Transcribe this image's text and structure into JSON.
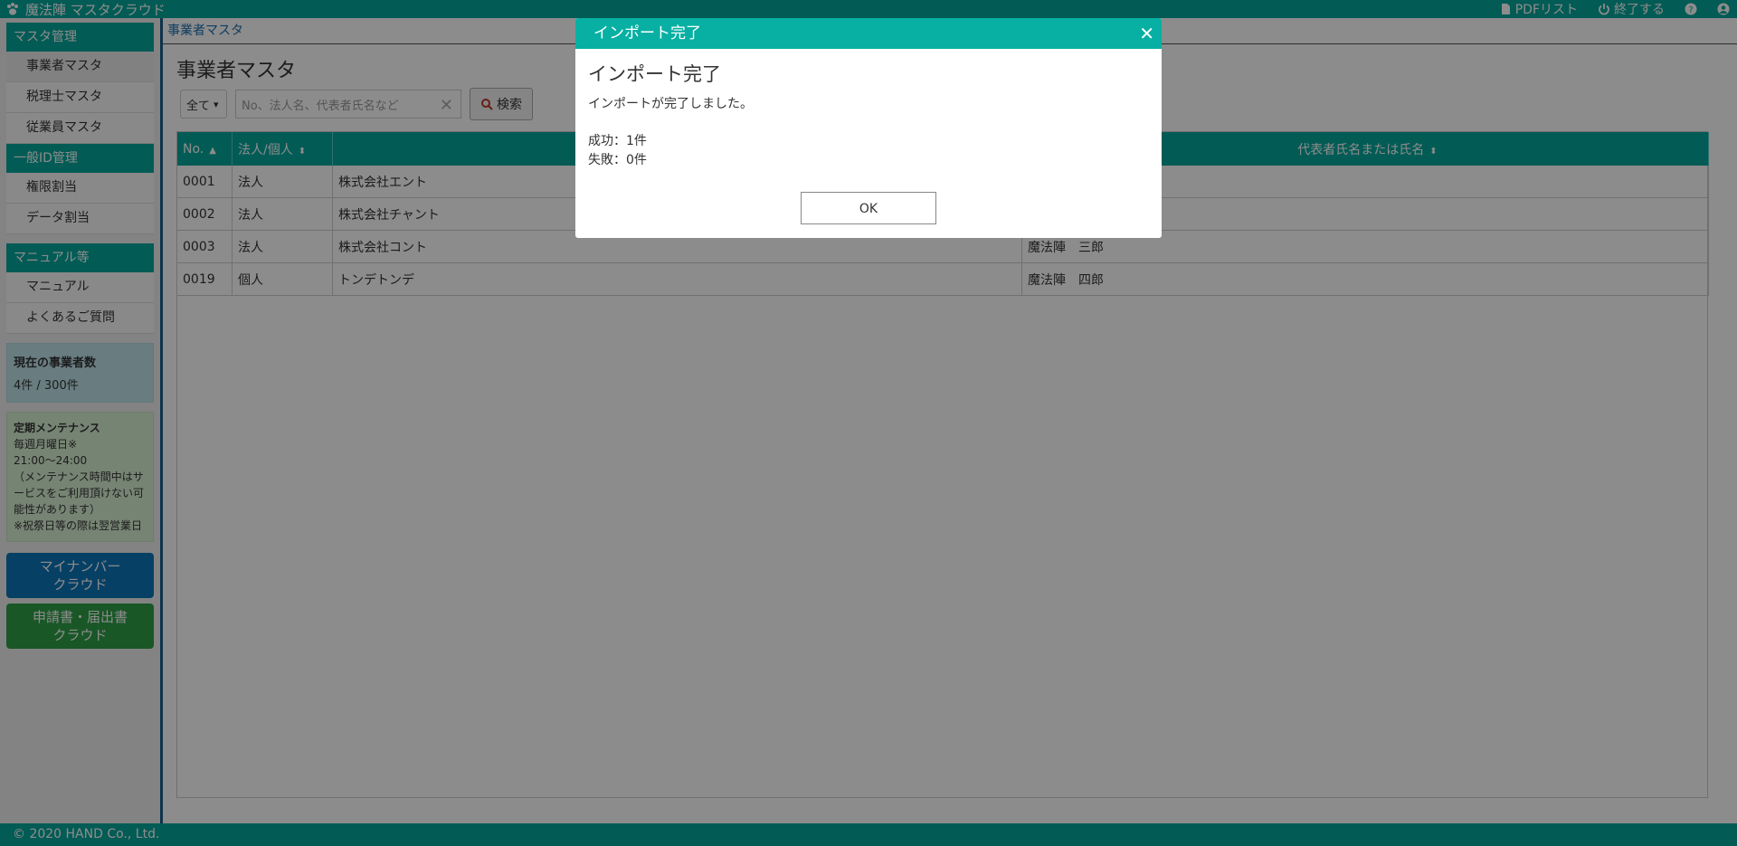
{
  "app": {
    "title": "魔法陣 マスタクラウド",
    "header_links": [
      {
        "label": "PDFリスト",
        "icon": "file-icon"
      },
      {
        "label": "終了する",
        "icon": "power-icon"
      },
      {
        "label": "",
        "icon": "help-icon"
      },
      {
        "label": "",
        "icon": "user-icon"
      }
    ]
  },
  "sidebar": {
    "groups": [
      {
        "title": "マスタ管理",
        "items": [
          "事業者マスタ",
          "税理士マスタ",
          "従業員マスタ"
        ]
      },
      {
        "title": "一般ID管理",
        "items": [
          "権限割当",
          "データ割当"
        ]
      },
      {
        "title": "マニュアル等",
        "items": [
          "マニュアル",
          "よくあるご質問"
        ]
      }
    ],
    "count_box": {
      "title": "現在の事業者数",
      "value": "4件 / 300件"
    },
    "maintenance": {
      "title": "定期メンテナンス",
      "lines": [
        "毎週月曜日※",
        "21:00〜24:00",
        "（メンテナンス時間中はサービスをご利用頂けない可能性があります）",
        "※祝祭日等の際は翌営業日"
      ]
    },
    "buttons": [
      {
        "label1": "マイナンバー",
        "label2": "クラウド",
        "color": "#0e75b8"
      },
      {
        "label1": "申請書・届出書",
        "label2": "クラウド",
        "color": "#2f9e48"
      }
    ]
  },
  "main": {
    "breadcrumb": "事業者マスタ",
    "page_title": "事業者マスタ",
    "filter_selected": "全て",
    "search_placeholder": "No、法人名、代表者氏名など",
    "search_button": "検索",
    "table": {
      "headers": [
        "No.",
        "法人/個人",
        "",
        "代表者氏名または氏名"
      ],
      "rows": [
        [
          "0001",
          "法人",
          "株式会社エント",
          ""
        ],
        [
          "0002",
          "法人",
          "株式会社チャント",
          ""
        ],
        [
          "0003",
          "法人",
          "株式会社コント",
          "魔法陣　三郎"
        ],
        [
          "0019",
          "個人",
          "トンデトンデ",
          "魔法陣　四郎"
        ]
      ]
    }
  },
  "footer": {
    "copyright": "© 2020 HAND Co., Ltd."
  },
  "modal": {
    "header": "インポート完了",
    "title": "インポート完了",
    "message": "インポートが完了しました。",
    "success": "成功：1件",
    "failure": "失敗：0件",
    "ok": "OK"
  },
  "colors": {
    "accent": "#07a79b",
    "overlay": "rgba(0,0,0,0.45)"
  }
}
